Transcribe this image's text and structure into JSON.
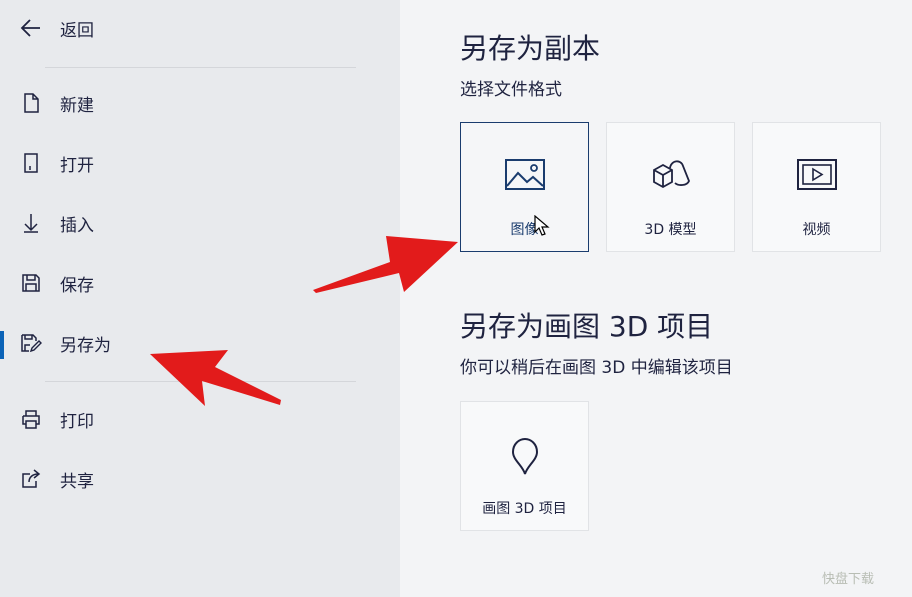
{
  "sidebar": {
    "back_label": "返回",
    "items": [
      {
        "label": "新建"
      },
      {
        "label": "打开"
      },
      {
        "label": "插入"
      },
      {
        "label": "保存"
      },
      {
        "label": "另存为",
        "active": true
      },
      {
        "label": "打印"
      },
      {
        "label": "共享"
      }
    ]
  },
  "save_copy": {
    "title": "另存为副本",
    "subtitle": "选择文件格式",
    "options": [
      {
        "label": "图像",
        "icon": "image-icon",
        "selected": true
      },
      {
        "label": "3D 模型",
        "icon": "3d-shapes-icon"
      },
      {
        "label": "视频",
        "icon": "video-icon"
      }
    ]
  },
  "save_project": {
    "title": "另存为画图 3D 项目",
    "subtitle": "你可以稍后在画图 3D 中编辑该项目",
    "options": [
      {
        "label": "画图 3D 项目",
        "icon": "paint3d-drop-icon"
      }
    ]
  },
  "watermark": "快盘下载",
  "colors": {
    "accent": "#0b63b7",
    "annotation_arrow": "#e21b1b",
    "sidebar_bg": "#e8eaed",
    "main_bg": "#f3f4f6"
  }
}
